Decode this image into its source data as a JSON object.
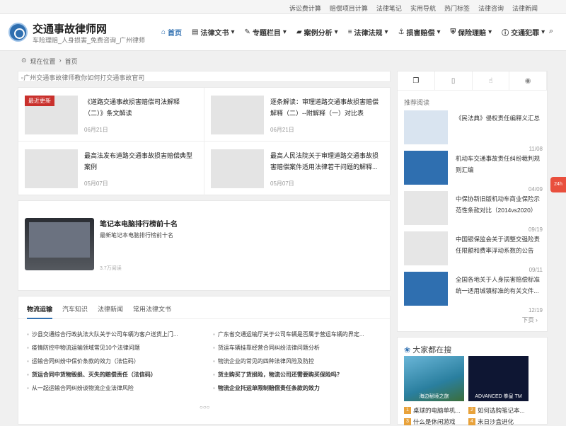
{
  "topbar": {
    "links": [
      "诉讼费计算",
      "赔偿项目计算",
      "法律笔记",
      "实用导航",
      "热门标签",
      "法律咨询",
      "法律新闻"
    ]
  },
  "site": {
    "title": "交通事故律师网",
    "subtitle": "车险理赔_人身损害_免费咨询_广州律师"
  },
  "nav": {
    "items": [
      {
        "label": "首页",
        "icon": "home-icon"
      },
      {
        "label": "法律文书",
        "icon": "document-icon"
      },
      {
        "label": "专题栏目",
        "icon": "pen-icon"
      },
      {
        "label": "案例分析",
        "icon": "folder-icon"
      },
      {
        "label": "法律法规",
        "icon": "list-icon"
      },
      {
        "label": "损害赔偿",
        "icon": "anchor-icon"
      },
      {
        "label": "保险理赔",
        "icon": "shield-icon"
      },
      {
        "label": "交通犯罪",
        "icon": "info-icon"
      }
    ]
  },
  "breadcrumb": {
    "prefix": "现在位置",
    "current": "首页"
  },
  "banner": {
    "alt": "广州交通事故律师教你如何打交通事故官司"
  },
  "latest": {
    "badge": "最近更新",
    "items": [
      {
        "title": "《道路交通事故损害赔偿司法解释（二）》条文解读",
        "date": "06月21日"
      },
      {
        "title": "逐条解读：审理道路交通事故损害赔偿解释（二）--附解释（一）对比表",
        "date": "06月21日"
      },
      {
        "title": "最高法发布道路交通事故损害赔偿典型案例",
        "date": "05月07日"
      },
      {
        "title": "最高人民法院关于审理道路交通事故损害赔偿案件适用法律若干问题的解释...",
        "date": "05月07日"
      }
    ]
  },
  "feature": {
    "title": "笔记本电脑排行榜前十名",
    "summary": "最新笔记本电脑排行榜前十名",
    "reads": "3.7万阅读"
  },
  "tabs": {
    "items": [
      "物流运输",
      "汽车知识",
      "法律新闻",
      "常用法律文书"
    ],
    "active": 0
  },
  "articles": {
    "left": [
      {
        "text": "沙县交通综合行政执法大队关于公司车辆为客户送货上门...",
        "bold": false
      },
      {
        "text": "疫情防控中物流运输领域常见10个法律问题",
        "bold": false
      },
      {
        "text": "运输合同纠纷中保价条款的效力（法信码）",
        "bold": false
      },
      {
        "text": "货运合同中货物毁损、灭失的赔偿责任（法信码）",
        "bold": true
      },
      {
        "text": "从一起运输合同纠纷谈物流企业法律风险",
        "bold": false
      }
    ],
    "right": [
      {
        "text": "广东省交通运输厅关于公司车辆是否属于营运车辆的界定...",
        "bold": false
      },
      {
        "text": "货运车辆挂靠经营合同纠纷法律问题分析",
        "bold": false
      },
      {
        "text": "物流企业的常见的四种法律风险及防控",
        "bold": false
      },
      {
        "text": "货主购买了货损险，物流公司还需要购买保险吗？",
        "bold": true
      },
      {
        "text": "物流企业托运单限制赔偿责任条款的效力",
        "bold": true
      }
    ]
  },
  "pager": {
    "dots": "○○○"
  },
  "sidebar": {
    "tabs": [
      "copy-icon",
      "file-icon",
      "thumb-icon",
      "eye-icon"
    ],
    "heading": "推荐阅读",
    "items": [
      {
        "title": "《民法典》侵权责任编释义汇总",
        "date": "11/08"
      },
      {
        "title": "机动车交通事故责任纠纷裁判规则汇编",
        "date": "04/09"
      },
      {
        "title": "中保协新旧版机动车商业保险示范性条款对比（2014vs2020）",
        "date": "09/19"
      },
      {
        "title": "中国银保监会关于调整交强险责任限额和费率浮动系数的公告",
        "date": "09/11"
      },
      {
        "title": "全国各地关于人身损害赔偿标准统一适用城镇标准的有关文件...",
        "date": "12/19"
      }
    ],
    "next": "下页"
  },
  "hot": {
    "heading": "大家都在搜",
    "images": [
      "海边秘境之旅",
      "ADVANCED 拳皇 TM"
    ],
    "ranks": [
      {
        "n": "1",
        "text": "桌球的电脑单机..."
      },
      {
        "n": "2",
        "text": "如何选购笔记本..."
      },
      {
        "n": "3",
        "text": "什么是休闲游戏"
      },
      {
        "n": "4",
        "text": "末日沙盒进化"
      }
    ]
  },
  "float": {
    "label": "24h"
  }
}
